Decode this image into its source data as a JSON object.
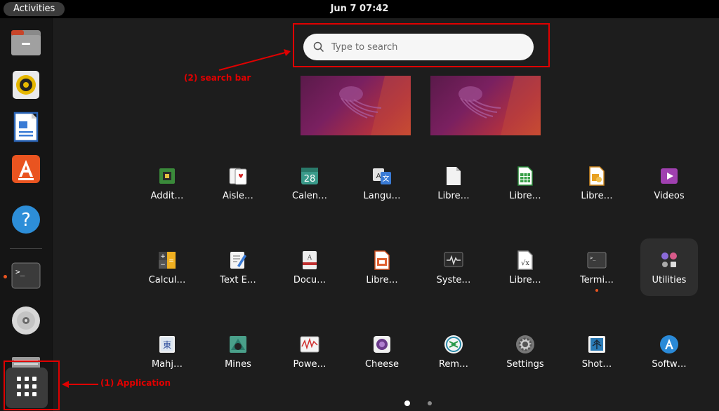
{
  "topbar": {
    "activities": "Activities",
    "clock": "Jun 7  07:42"
  },
  "search": {
    "placeholder": "Type to search"
  },
  "annotations": {
    "search": "(2) search bar",
    "apps": "(1) Application"
  },
  "dock": [
    {
      "name": "files",
      "icon": "folder-icon"
    },
    {
      "name": "rhythmbox",
      "icon": "speaker-icon"
    },
    {
      "name": "writer",
      "icon": "document-icon"
    },
    {
      "name": "app-center",
      "icon": "store-icon"
    },
    {
      "name": "help",
      "icon": "help-icon"
    },
    {
      "name": "terminal",
      "icon": "terminal-icon",
      "running": true
    },
    {
      "name": "dvd",
      "icon": "disc-icon"
    },
    {
      "name": "stack",
      "icon": "drive-icon"
    },
    {
      "name": "show-apps",
      "icon": "grid-icon"
    }
  ],
  "apps": [
    {
      "label": "Addit…",
      "icon": "chip-icon"
    },
    {
      "label": "Aisle…",
      "icon": "cards-icon"
    },
    {
      "label": "Calen…",
      "icon": "calendar-icon",
      "text": "28"
    },
    {
      "label": "Langu…",
      "icon": "translate-icon"
    },
    {
      "label": "Libre…",
      "icon": "blank-doc-icon"
    },
    {
      "label": "Libre…",
      "icon": "spreadsheet-icon"
    },
    {
      "label": "Libre…",
      "icon": "draw-icon"
    },
    {
      "label": "Videos",
      "icon": "play-icon"
    },
    {
      "label": "Calcul…",
      "icon": "calculator-icon"
    },
    {
      "label": "Text E…",
      "icon": "text-editor-icon"
    },
    {
      "label": "Docu…",
      "icon": "document-viewer-icon"
    },
    {
      "label": "Libre…",
      "icon": "impress-icon"
    },
    {
      "label": "Syste…",
      "icon": "monitor-icon"
    },
    {
      "label": "Libre…",
      "icon": "math-icon"
    },
    {
      "label": "Termi…",
      "icon": "terminal-icon",
      "running": true
    },
    {
      "label": "Utilities",
      "icon": "utilities-icon",
      "selected": true
    },
    {
      "label": "Mahj…",
      "icon": "mahjong-icon"
    },
    {
      "label": "Mines",
      "icon": "mines-icon"
    },
    {
      "label": "Powe…",
      "icon": "power-icon"
    },
    {
      "label": "Cheese",
      "icon": "camera-icon"
    },
    {
      "label": "Rem…",
      "icon": "remmina-icon"
    },
    {
      "label": "Settings",
      "icon": "gear-icon"
    },
    {
      "label": "Shot…",
      "icon": "shotwell-icon"
    },
    {
      "label": "Softw…",
      "icon": "software-icon"
    }
  ],
  "colors": {
    "accent": "#e95420",
    "annotation": "#e00000",
    "background": "#1d1d1d"
  }
}
